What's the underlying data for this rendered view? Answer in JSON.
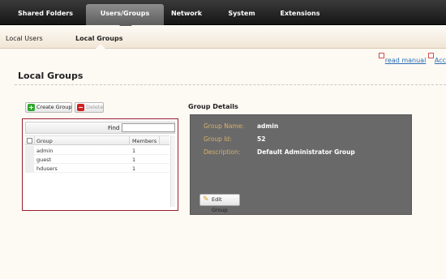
{
  "topnav": {
    "tabs": [
      {
        "label": "Shared Folders"
      },
      {
        "label": "Users/Groups",
        "active": true
      },
      {
        "label": "Network"
      },
      {
        "label": "System"
      },
      {
        "label": "Extensions"
      }
    ]
  },
  "subnav": {
    "items": [
      {
        "label": "Local Users"
      },
      {
        "label": "Local Groups",
        "active": true
      }
    ]
  },
  "links": {
    "read_manual": "read manual",
    "second": "Acc"
  },
  "page": {
    "title": "Local Groups"
  },
  "toolbar": {
    "create_label": "Create Group",
    "delete_label": "Delete"
  },
  "grid": {
    "find_label": "Find",
    "find_value": "",
    "columns": [
      "Group",
      "Members"
    ],
    "rows": [
      {
        "group": "admin",
        "members": "1"
      },
      {
        "group": "guest",
        "members": "1"
      },
      {
        "group": "hdusers",
        "members": "1"
      }
    ]
  },
  "details": {
    "title": "Group Details",
    "name_label": "Group Name:",
    "name_value": "admin",
    "id_label": "Group Id:",
    "id_value": "52",
    "desc_label": "Description:",
    "desc_value": "Default Administrator Group",
    "edit_label": "Edit Group"
  },
  "colors": {
    "accent": "#9a1f2e",
    "link": "#2a6fb5",
    "detail_label": "#d9b06a",
    "panel": "#696969"
  },
  "icons": [
    "plus-icon",
    "minus-icon",
    "external-link-icon",
    "pencil-icon",
    "checkbox-icon"
  ]
}
